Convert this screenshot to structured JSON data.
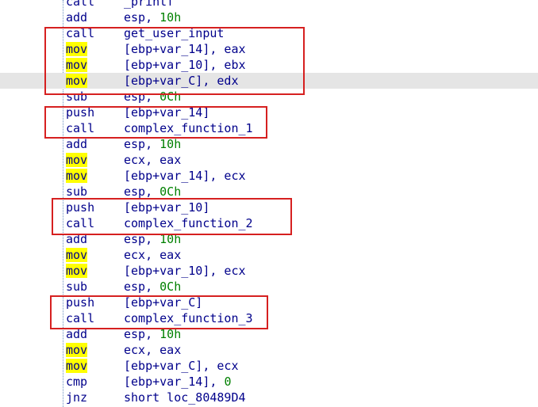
{
  "colors": {
    "mnemonic_text": "#00008b",
    "operand_text": "#00008b",
    "immediate_number": "#008000",
    "mov_highlight": "#ffff00",
    "current_line_highlight": "#e5e5e5",
    "annotation_box": "#d62020"
  },
  "lines": [
    {
      "mnemonic": "call",
      "operand": "_printf",
      "number": "",
      "yellow": false,
      "current": false
    },
    {
      "mnemonic": "add",
      "operand": "esp, ",
      "number": "10h",
      "yellow": false,
      "current": false
    },
    {
      "mnemonic": "call",
      "operand": "get_user_input",
      "number": "",
      "yellow": false,
      "current": false
    },
    {
      "mnemonic": "mov",
      "operand": "[ebp+var_14], eax",
      "number": "",
      "yellow": true,
      "current": false
    },
    {
      "mnemonic": "mov",
      "operand": "[ebp+var_10], ebx",
      "number": "",
      "yellow": true,
      "current": false
    },
    {
      "mnemonic": "mov",
      "operand": "[ebp+var_C], edx",
      "number": "",
      "yellow": true,
      "current": true
    },
    {
      "mnemonic": "sub",
      "operand": "esp, ",
      "number": "0Ch",
      "yellow": false,
      "current": false
    },
    {
      "mnemonic": "push",
      "operand": "[ebp+var_14]",
      "number": "",
      "yellow": false,
      "current": false
    },
    {
      "mnemonic": "call",
      "operand": "complex_function_1",
      "number": "",
      "yellow": false,
      "current": false
    },
    {
      "mnemonic": "add",
      "operand": "esp, ",
      "number": "10h",
      "yellow": false,
      "current": false
    },
    {
      "mnemonic": "mov",
      "operand": "ecx, eax",
      "number": "",
      "yellow": true,
      "current": false
    },
    {
      "mnemonic": "mov",
      "operand": "[ebp+var_14], ecx",
      "number": "",
      "yellow": true,
      "current": false
    },
    {
      "mnemonic": "sub",
      "operand": "esp, ",
      "number": "0Ch",
      "yellow": false,
      "current": false
    },
    {
      "mnemonic": "push",
      "operand": "[ebp+var_10]",
      "number": "",
      "yellow": false,
      "current": false
    },
    {
      "mnemonic": "call",
      "operand": "complex_function_2",
      "number": "",
      "yellow": false,
      "current": false
    },
    {
      "mnemonic": "add",
      "operand": "esp, ",
      "number": "10h",
      "yellow": false,
      "current": false
    },
    {
      "mnemonic": "mov",
      "operand": "ecx, eax",
      "number": "",
      "yellow": true,
      "current": false
    },
    {
      "mnemonic": "mov",
      "operand": "[ebp+var_10], ecx",
      "number": "",
      "yellow": true,
      "current": false
    },
    {
      "mnemonic": "sub",
      "operand": "esp, ",
      "number": "0Ch",
      "yellow": false,
      "current": false
    },
    {
      "mnemonic": "push",
      "operand": "[ebp+var_C]",
      "number": "",
      "yellow": false,
      "current": false
    },
    {
      "mnemonic": "call",
      "operand": "complex_function_3",
      "number": "",
      "yellow": false,
      "current": false
    },
    {
      "mnemonic": "add",
      "operand": "esp, ",
      "number": "10h",
      "yellow": false,
      "current": false
    },
    {
      "mnemonic": "mov",
      "operand": "ecx, eax",
      "number": "",
      "yellow": true,
      "current": false
    },
    {
      "mnemonic": "mov",
      "operand": "[ebp+var_C], ecx",
      "number": "",
      "yellow": true,
      "current": false
    },
    {
      "mnemonic": "cmp",
      "operand": "[ebp+var_14], ",
      "number": "0",
      "yellow": false,
      "current": false
    },
    {
      "mnemonic": "jnz",
      "operand": "short loc_80489D4",
      "number": "",
      "yellow": false,
      "current": false
    }
  ]
}
